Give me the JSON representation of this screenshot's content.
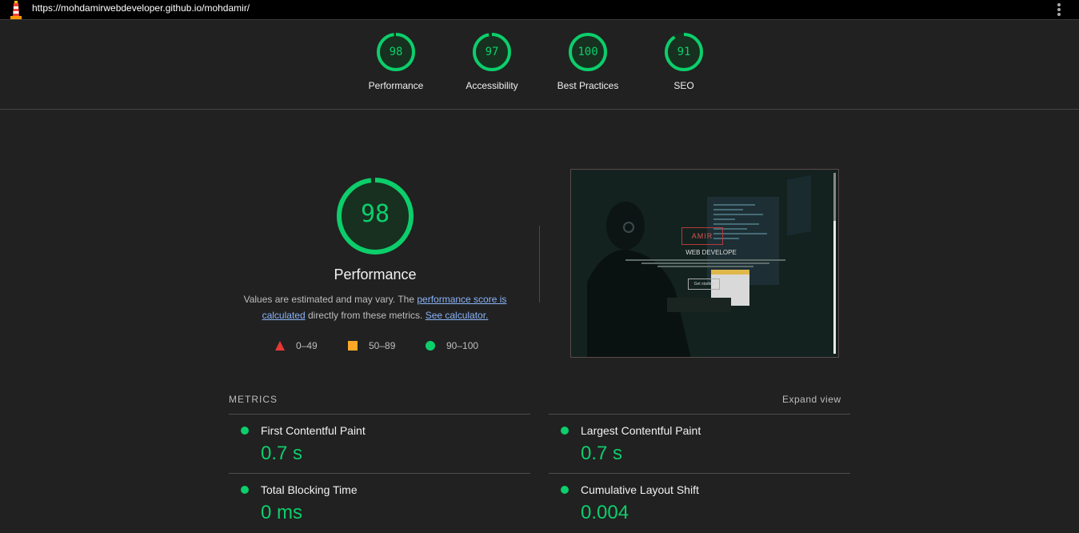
{
  "topbar": {
    "url": "https://mohdamirwebdeveloper.github.io/mohdamir/"
  },
  "scores": [
    {
      "value": "98",
      "label": "Performance",
      "fraction": 0.98
    },
    {
      "value": "97",
      "label": "Accessibility",
      "fraction": 0.97
    },
    {
      "value": "100",
      "label": "Best Practices",
      "fraction": 1.0
    },
    {
      "value": "91",
      "label": "SEO",
      "fraction": 0.91
    }
  ],
  "performance": {
    "score": "98",
    "fraction": 0.98,
    "title": "Performance",
    "desc_prefix": "Values are estimated and may vary. The ",
    "link_score": "performance score is calculated",
    "desc_mid": " directly from these metrics. ",
    "link_calc": "See calculator.",
    "legend": [
      {
        "range": "0–49",
        "shape": "triangle",
        "color": "#e53935"
      },
      {
        "range": "50–89",
        "shape": "square",
        "color": "#ffa726"
      },
      {
        "range": "90–100",
        "shape": "circle",
        "color": "#0cce6b"
      }
    ]
  },
  "screenshot": {
    "brand": "AMIR",
    "subtitle": "WEB DEVELOPE",
    "cta": "Get started"
  },
  "metrics": {
    "header": "METRICS",
    "expand": "Expand view",
    "items": [
      {
        "name": "First Contentful Paint",
        "value": "0.7 s"
      },
      {
        "name": "Largest Contentful Paint",
        "value": "0.7 s"
      },
      {
        "name": "Total Blocking Time",
        "value": "0 ms"
      },
      {
        "name": "Cumulative Layout Shift",
        "value": "0.004"
      }
    ]
  },
  "colors": {
    "pass": "#0cce6b",
    "background": "#212121"
  }
}
